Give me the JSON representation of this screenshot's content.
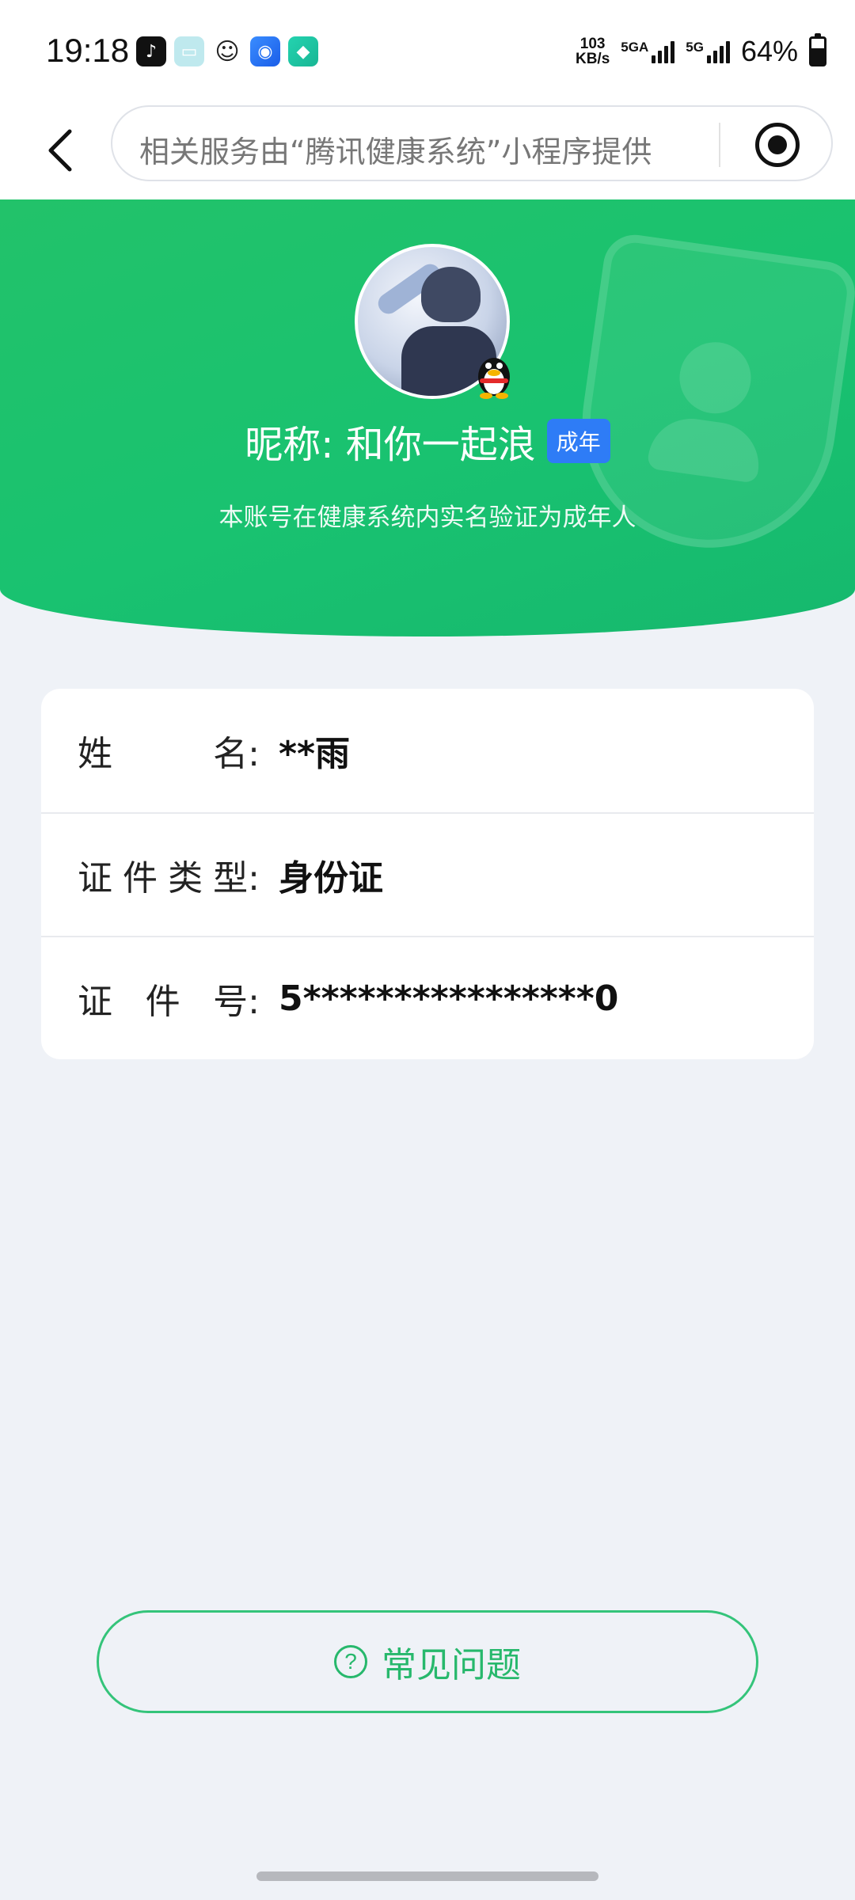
{
  "status_bar": {
    "time": "19:18",
    "speed_value": "103",
    "speed_unit": "KB/s",
    "sim1_label": "5GA",
    "sim2_label": "5G",
    "battery_percent": "64%",
    "notification_icons": [
      "tiktok-icon",
      "message-icon",
      "wechat-icon",
      "browser-icon",
      "app-store-icon"
    ]
  },
  "nav": {
    "search_text": "相关服务由“腾讯健康系统”小程序提供"
  },
  "profile": {
    "nickname": "昵称: 和你一起浪",
    "badge": "成年",
    "verify_text": "本账号在健康系统内实名验证为成年人"
  },
  "info": {
    "rows": [
      {
        "label_chars": [
          "姓",
          "名:"
        ],
        "value": "**雨"
      },
      {
        "label_chars": [
          "证",
          "件",
          "类",
          "型:"
        ],
        "value": "身份证"
      },
      {
        "label_chars": [
          "证",
          "件",
          "号:"
        ],
        "value": "5****************0"
      }
    ]
  },
  "faq": {
    "icon": "?",
    "label": "常见问题"
  },
  "colors": {
    "brand_green": "#19c270",
    "badge_blue": "#2e7cf6",
    "faq_green": "#27b86c",
    "background": "#eff2f7"
  }
}
